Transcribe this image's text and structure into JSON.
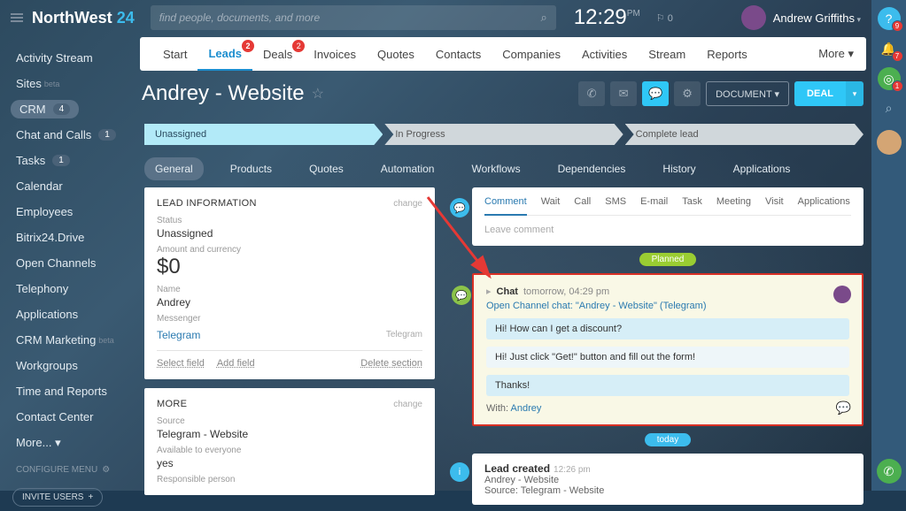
{
  "logo": {
    "a": "NorthWest",
    "b": "24"
  },
  "search": {
    "placeholder": "find people, documents, and more"
  },
  "clock": {
    "time": "12:29",
    "period": "PM"
  },
  "cart": "⚐ 0",
  "user": "Andrew Griffiths",
  "rail": {
    "help": "9",
    "bell": "7",
    "green": "1"
  },
  "sidebar": [
    {
      "label": "Activity Stream"
    },
    {
      "label": "Sites",
      "beta": "beta"
    },
    {
      "label": "CRM",
      "badge": "4",
      "pill": true
    },
    {
      "label": "Chat and Calls",
      "badge": "1"
    },
    {
      "label": "Tasks",
      "badge": "1"
    },
    {
      "label": "Calendar"
    },
    {
      "label": "Employees"
    },
    {
      "label": "Bitrix24.Drive"
    },
    {
      "label": "Open Channels"
    },
    {
      "label": "Telephony"
    },
    {
      "label": "Applications"
    },
    {
      "label": "CRM Marketing",
      "beta": "beta"
    },
    {
      "label": "Workgroups"
    },
    {
      "label": "Time and Reports"
    },
    {
      "label": "Contact Center"
    },
    {
      "label": "More... ▾"
    }
  ],
  "configure": "CONFIGURE MENU",
  "invite": "INVITE USERS",
  "tabs": [
    {
      "label": "Start"
    },
    {
      "label": "Leads",
      "badge": "2",
      "active": true
    },
    {
      "label": "Deals",
      "badge": "2"
    },
    {
      "label": "Invoices"
    },
    {
      "label": "Quotes"
    },
    {
      "label": "Contacts"
    },
    {
      "label": "Companies"
    },
    {
      "label": "Activities"
    },
    {
      "label": "Stream"
    },
    {
      "label": "Reports"
    }
  ],
  "tabs_more": "More ▾",
  "title": "Andrey - Website",
  "doc_btn": "DOCUMENT ▾",
  "deal_btn": "DEAL",
  "stages": [
    {
      "label": "Unassigned",
      "active": true
    },
    {
      "label": "In Progress"
    },
    {
      "label": "Complete lead"
    }
  ],
  "subtabs": [
    "General",
    "Products",
    "Quotes",
    "Automation",
    "Workflows",
    "Dependencies",
    "History",
    "Applications"
  ],
  "lead_info": {
    "title": "LEAD INFORMATION",
    "change": "change",
    "status_l": "Status",
    "status_v": "Unassigned",
    "amount_l": "Amount and currency",
    "amount_v": "$0",
    "name_l": "Name",
    "name_v": "Andrey",
    "msg_l": "Messenger",
    "msg_v": "Telegram",
    "msg_extra": "Telegram",
    "select": "Select field",
    "add": "Add field",
    "del": "Delete section"
  },
  "more_card": {
    "title": "MORE",
    "change": "change",
    "src_l": "Source",
    "src_v": "Telegram - Website",
    "avail_l": "Available to everyone",
    "avail_v": "yes",
    "resp_l": "Responsible person"
  },
  "comment": {
    "tabs": [
      "Comment",
      "Wait",
      "Call",
      "SMS",
      "E-mail",
      "Task",
      "Meeting",
      "Visit",
      "Applications"
    ],
    "leave": "Leave comment"
  },
  "planned": "Planned",
  "chat": {
    "head": "Chat",
    "time": "tomorrow, 04:29 pm",
    "link": "Open Channel chat: \"Andrey - Website\" (Telegram)",
    "m1": "Hi! How can I get a discount?",
    "m2": "Hi! Just click \"Get!\" button and fill out the form!",
    "m3": "Thanks!",
    "with": "With:",
    "with_name": "Andrey"
  },
  "today": "today",
  "lead_created": {
    "title": "Lead created",
    "time": "12:26 pm",
    "name": "Andrey - Website",
    "src": "Source: Telegram - Website"
  }
}
